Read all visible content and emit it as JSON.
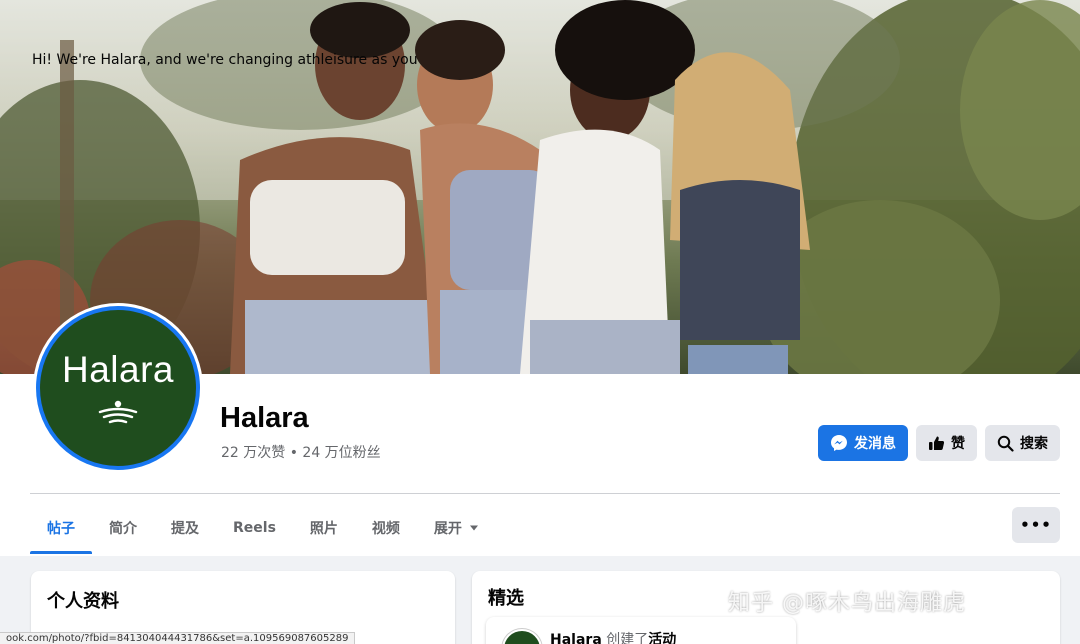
{
  "page": {
    "name": "Halara",
    "stats": "22 万次赞 • 24 万位粉丝",
    "avatar_text": "Halara"
  },
  "actions": {
    "message_label": "发消息",
    "like_label": "赞",
    "search_label": "搜索",
    "more_label": "•••"
  },
  "tabs": [
    {
      "label": "帖子",
      "active": true
    },
    {
      "label": "简介"
    },
    {
      "label": "提及"
    },
    {
      "label": "Reels"
    },
    {
      "label": "照片"
    },
    {
      "label": "视频"
    },
    {
      "label": "展开"
    }
  ],
  "profile_card": {
    "title": "个人资料",
    "intro": "Hi! We're Halara, and we're changing athleisure as you"
  },
  "featured_card": {
    "title": "精选",
    "item_name": "Halara",
    "item_action": "创建了",
    "item_object": "活动"
  },
  "status_bar": {
    "url": "ook.com/photo/?fbid=841304044431786&set=a.109569087605289"
  },
  "watermark": "知乎 @啄木鸟出海雕虎",
  "colors": {
    "accent": "#1b74e4",
    "avatar_bg": "#1f4d1e",
    "avatar_ring": "#1877f2"
  }
}
